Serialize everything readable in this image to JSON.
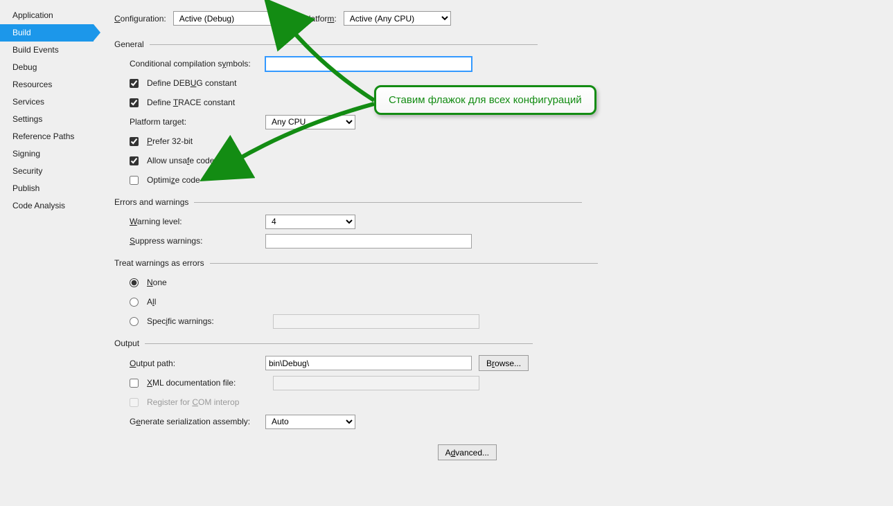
{
  "sidebar": {
    "items": [
      {
        "label": "Application"
      },
      {
        "label": "Build"
      },
      {
        "label": "Build Events"
      },
      {
        "label": "Debug"
      },
      {
        "label": "Resources"
      },
      {
        "label": "Services"
      },
      {
        "label": "Settings"
      },
      {
        "label": "Reference Paths"
      },
      {
        "label": "Signing"
      },
      {
        "label": "Security"
      },
      {
        "label": "Publish"
      },
      {
        "label": "Code Analysis"
      }
    ],
    "active_index": 1
  },
  "top": {
    "config_label": "Configuration:",
    "config_value": "Active (Debug)",
    "platform_label": "Platform:",
    "platform_value": "Active (Any CPU)"
  },
  "sections": {
    "general": {
      "title": "General",
      "cond_label": "Conditional compilation symbols:",
      "cond_value": "",
      "debug_label": "Define DEBUG constant",
      "debug_checked": true,
      "trace_label": "Define TRACE constant",
      "trace_checked": true,
      "plat_target_label": "Platform target:",
      "plat_target_value": "Any CPU",
      "prefer32_label": "Prefer 32-bit",
      "prefer32_checked": true,
      "unsafe_label": "Allow unsafe code",
      "unsafe_checked": true,
      "optimize_label": "Optimize code",
      "optimize_checked": false
    },
    "errors": {
      "title": "Errors and warnings",
      "warn_level_label": "Warning level:",
      "warn_level_value": "4",
      "suppress_label": "Suppress warnings:",
      "suppress_value": ""
    },
    "treat": {
      "title": "Treat warnings as errors",
      "none_label": "None",
      "all_label": "All",
      "specific_label": "Specific warnings:",
      "specific_value": "",
      "selected": "none"
    },
    "output": {
      "title": "Output",
      "path_label": "Output path:",
      "path_value": "bin\\Debug\\",
      "browse_label": "Browse...",
      "xmldoc_label": "XML documentation file:",
      "xmldoc_checked": false,
      "xmldoc_value": "",
      "com_label": "Register for COM interop",
      "com_checked": false,
      "gensa_label": "Generate serialization assembly:",
      "gensa_value": "Auto",
      "advanced_label": "Advanced..."
    }
  },
  "annotation": {
    "text": "Ставим флажок для всех конфигураций",
    "color": "#138c13"
  }
}
